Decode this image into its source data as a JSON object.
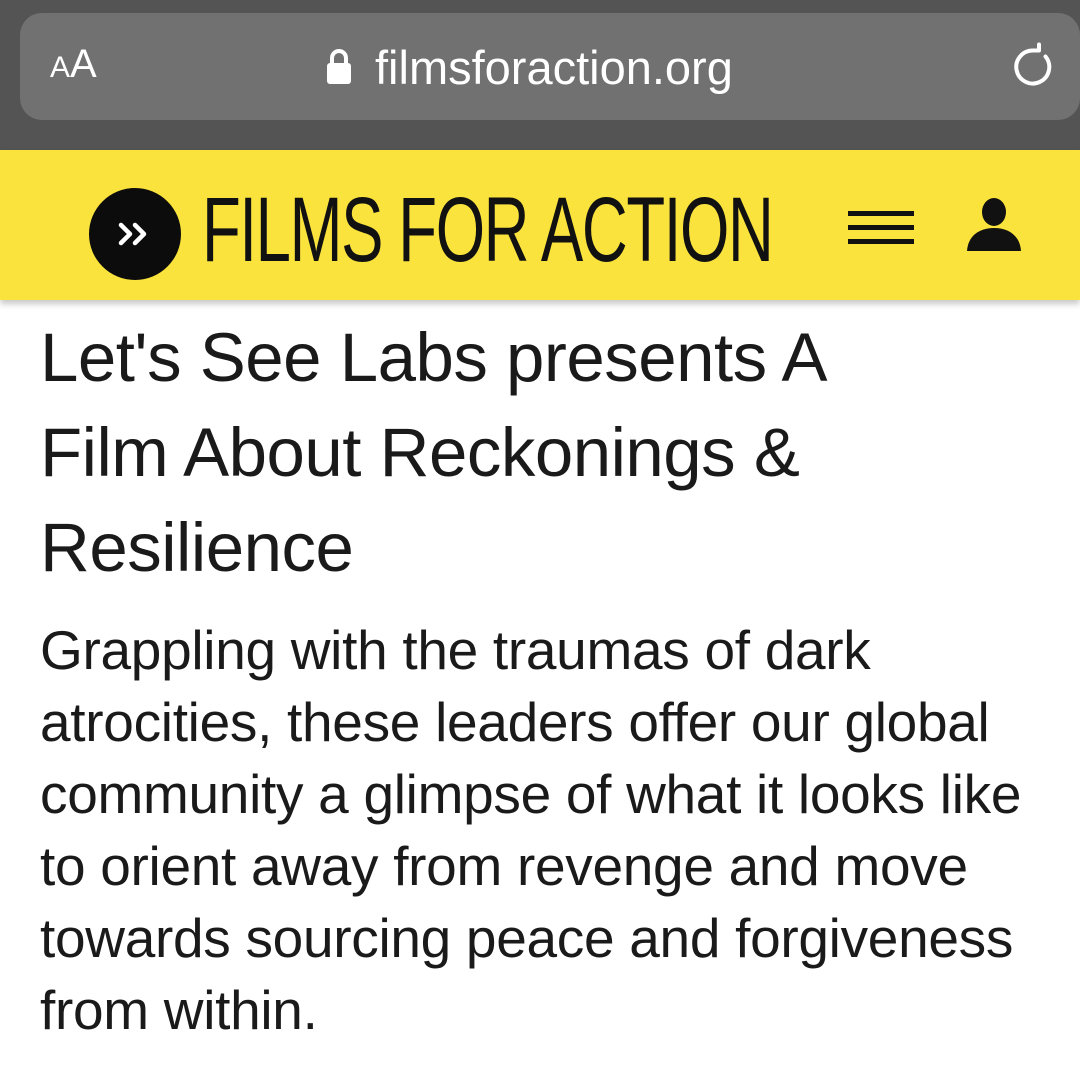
{
  "browser": {
    "text_size_small": "A",
    "text_size_large": "A",
    "lock_icon": "lock-icon",
    "url": "filmsforaction.org",
    "reload_icon": "reload-icon",
    "chrome_color": "#545454"
  },
  "header": {
    "logo_icon": "double-chevron-right-icon",
    "site_name": "FILMS FOR ACTION",
    "menu_icon": "hamburger-menu-icon",
    "account_icon": "user-icon",
    "background_color": "#fae33c"
  },
  "article": {
    "title": "Let's See Labs presents A Film About Reckonings & Resilience",
    "summary": "Grappling with the traumas of dark atrocities, these leaders offer our global community a glimpse of what it looks like to orient away from revenge and move towards sourcing peace and forgiveness from within."
  }
}
